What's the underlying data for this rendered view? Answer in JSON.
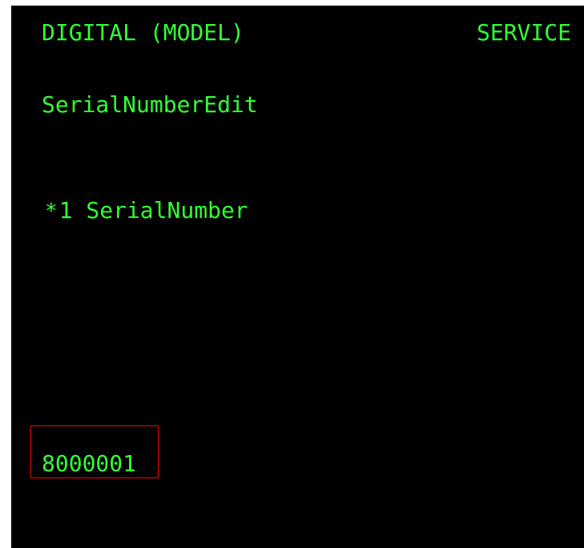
{
  "header": {
    "left": "DIGITAL (MODEL)",
    "right": "SERVICE"
  },
  "menu": {
    "title": "SerialNumberEdit",
    "items": [
      {
        "marker": "*",
        "number": "1",
        "label": "SerialNumber"
      }
    ]
  },
  "input": {
    "value": "8000001",
    "highlight_color": "#ff0000"
  },
  "colors": {
    "background": "#000000",
    "text": "#33ff33"
  }
}
